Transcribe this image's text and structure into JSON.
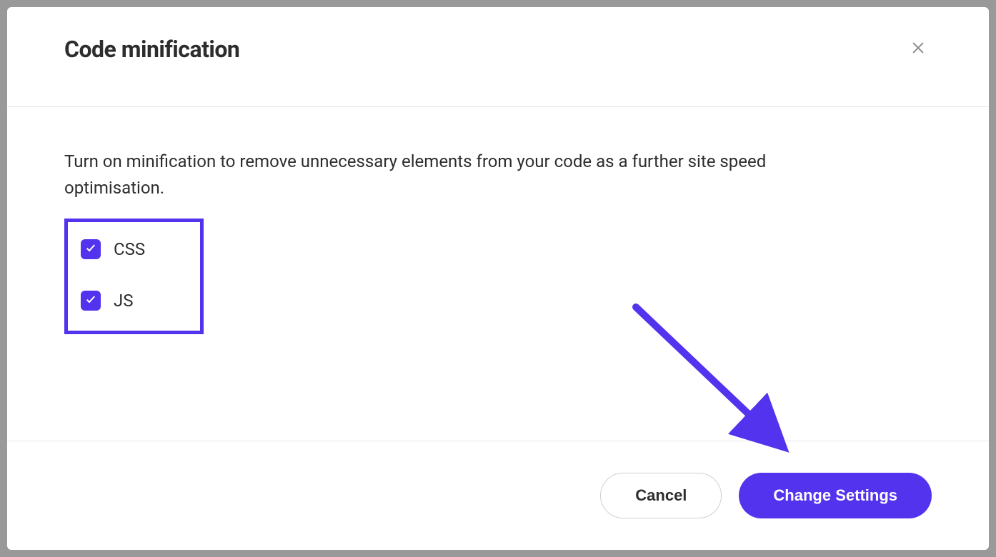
{
  "modal": {
    "title": "Code minification",
    "description": "Turn on minification to remove unnecessary elements from your code as a further site speed optimisation.",
    "options": [
      {
        "label": "CSS",
        "checked": true
      },
      {
        "label": "JS",
        "checked": true
      }
    ],
    "buttons": {
      "cancel": "Cancel",
      "confirm": "Change Settings"
    }
  },
  "colors": {
    "accent": "#5333ed"
  }
}
